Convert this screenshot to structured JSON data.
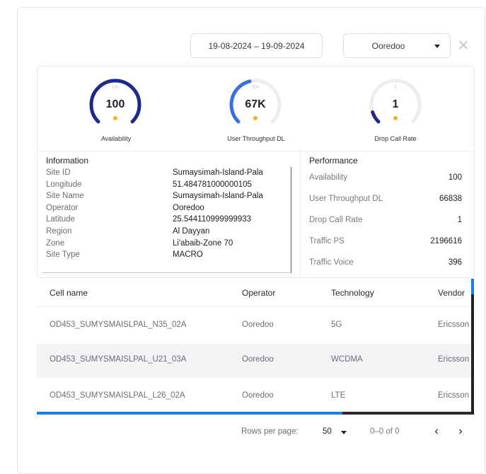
{
  "filters": {
    "date_range": "19-08-2024 – 19-09-2024",
    "operator": "Ooredoo"
  },
  "gauges": [
    {
      "label": "Availability",
      "max": "100",
      "value": "100",
      "fraction": 1.0,
      "color": "#1d2a8a"
    },
    {
      "label": "User Throughput DL",
      "max": "35K",
      "value": "67K",
      "fraction": 0.45,
      "color": "#3a6fe0"
    },
    {
      "label": "Drop Call Rate",
      "max": "3",
      "value": "1",
      "fraction": 0.1,
      "color": "#1d2a8a"
    }
  ],
  "information": {
    "title": "Information",
    "rows": [
      {
        "key": "Site ID",
        "value": "Sumaysimah-Island-Pala"
      },
      {
        "key": "Longitude",
        "value": "51.484781000000105"
      },
      {
        "key": "Site Name",
        "value": "Sumaysimah-Island-Pala"
      },
      {
        "key": "Operator",
        "value": "Ooredoo"
      },
      {
        "key": "Latitude",
        "value": "25.544110999999933"
      },
      {
        "key": "Region",
        "value": "Al Dayyan"
      },
      {
        "key": "Zone",
        "value": "Li'abaib-Zone 70"
      },
      {
        "key": "Site Type",
        "value": "MACRO"
      }
    ]
  },
  "performance": {
    "title": "Performance",
    "rows": [
      {
        "key": "Availability",
        "value": "100"
      },
      {
        "key": "User Throughput DL",
        "value": "66838"
      },
      {
        "key": "Drop Call Rate",
        "value": "1"
      },
      {
        "key": "Traffic PS",
        "value": "2196616"
      },
      {
        "key": "Traffic Voice",
        "value": "396"
      }
    ]
  },
  "table": {
    "columns": [
      "Cell name",
      "Operator",
      "Technology",
      "Vendor"
    ],
    "rows": [
      [
        "OD453_SUMYSMAISLPAL_N35_02A",
        "Ooredoo",
        "5G",
        "Ericsson"
      ],
      [
        "OD453_SUMYSMAISLPAL_U21_03A",
        "Ooredoo",
        "WCDMA",
        "Ericsson"
      ],
      [
        "OD453_SUMYSMAISLPAL_L26_02A",
        "Ooredoo",
        "LTE",
        "Ericsson"
      ]
    ]
  },
  "pagination": {
    "rows_per_page_label": "Rows per page:",
    "rows_per_page": "50",
    "range": "0–0 of 0",
    "prev_icon": "chevron-left-icon",
    "next_icon": "chevron-right-icon"
  }
}
